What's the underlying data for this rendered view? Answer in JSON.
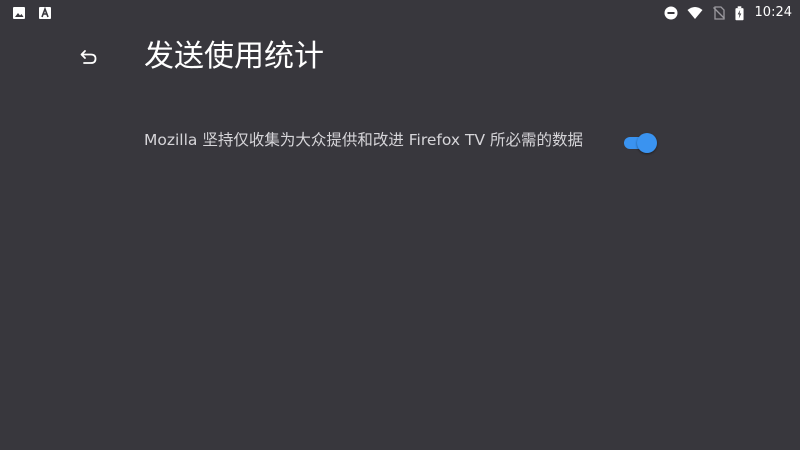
{
  "status_bar": {
    "time": "10:24",
    "left_icons": [
      "image-icon",
      "font-icon"
    ],
    "right_icons": [
      "do-not-disturb-icon",
      "wifi-icon",
      "no-sim-icon",
      "battery-charging-icon"
    ]
  },
  "toolbar": {
    "back_icon": "back-arrow-icon",
    "title": "发送使用统计"
  },
  "preference": {
    "summary": "Mozilla 坚持仅收集为大众提供和改进 Firefox TV 所必需的数据",
    "enabled": true
  },
  "colors": {
    "background": "#38373d",
    "accent": "#3a93f0",
    "text_primary": "#ffffff",
    "text_secondary": "#d6d5d9"
  }
}
